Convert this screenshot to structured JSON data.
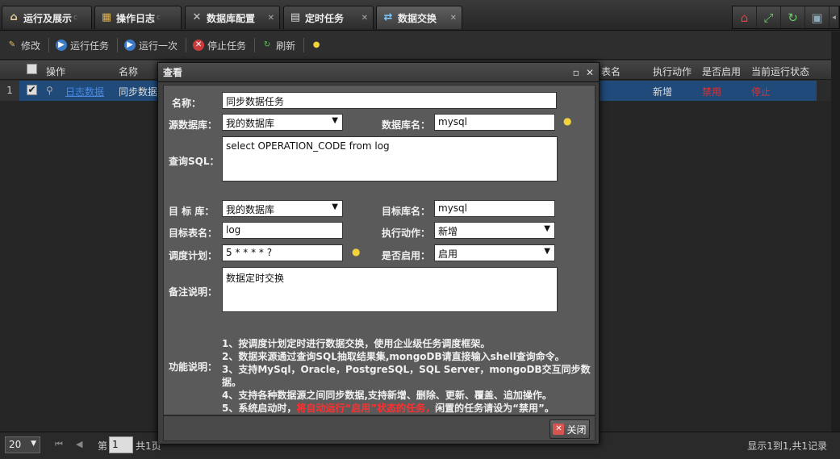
{
  "tabs": [
    {
      "label": "运行及展示",
      "icon": "home-icon"
    },
    {
      "label": "操作日志",
      "icon": "sitemap-icon"
    },
    {
      "label": "数据库配置",
      "icon": "tools-icon"
    },
    {
      "label": "定时任务",
      "icon": "document-icon"
    },
    {
      "label": "数据交换",
      "icon": "exchange-icon"
    }
  ],
  "toolbar": {
    "edit": "修改",
    "run": "运行任务",
    "run_once": "运行一次",
    "stop": "停止任务",
    "refresh": "刷新"
  },
  "grid": {
    "headers": {
      "action": "操作",
      "name": "名称",
      "table": "表名",
      "exec_action": "执行动作",
      "enabled": "是否启用",
      "status": "当前运行状态"
    },
    "row": {
      "num": "1",
      "view": "日志数据",
      "name": "同步数据",
      "exec_action": "新增",
      "enabled": "禁用",
      "status": "停止"
    }
  },
  "pager": {
    "page_size": "20",
    "page_prefix": "第",
    "page_value": "1",
    "page_suffix": "共1页",
    "summary": "显示1到1,共1记录"
  },
  "dialog": {
    "title": "查看",
    "name_label": "名称：",
    "name_value": "同步数据任务",
    "source_db_label": "源数据库：",
    "source_db_value": "我的数据库",
    "db_name_label": "数据库名：",
    "db_name_value": "mysql",
    "sql_label": "查询SQL：",
    "sql_value": "select  OPERATION_CODE from log",
    "target_db_label": "目 标 库：",
    "target_db_value": "我的数据库",
    "target_db_name_label": "目标库名：",
    "target_db_name_value": "mysql",
    "target_table_label": "目标表名：",
    "target_table_value": "log",
    "exec_action_label": "执行动作：",
    "exec_action_value": "新增",
    "schedule_label": "调度计划：",
    "schedule_value": "5 * * * * ?",
    "enabled_label": "是否启用：",
    "enabled_value": "启用",
    "remark_label": "备注说明：",
    "remark_value": "数据定时交换",
    "func_label": "功能说明：",
    "notes": [
      "1、按调度计划定时进行数据交换，使用企业级任务调度框架。",
      "2、数据来源通过查询SQL抽取结果集,mongoDB请直接输入shell查询命令。",
      "3、支持MySql，Oracle，PostgreSQL，SQL Server，mongoDB交互同步数据。",
      "4、支持各种数据源之间同步数据,支持新增、删除、更新、覆盖、追加操作。"
    ],
    "note5_a": "5、系统启动时，",
    "note5_red": "将自动运行“启用”状态的任务，",
    "note5_b": "闲置的任务请设为“禁用”。",
    "close_label": "关闭"
  }
}
